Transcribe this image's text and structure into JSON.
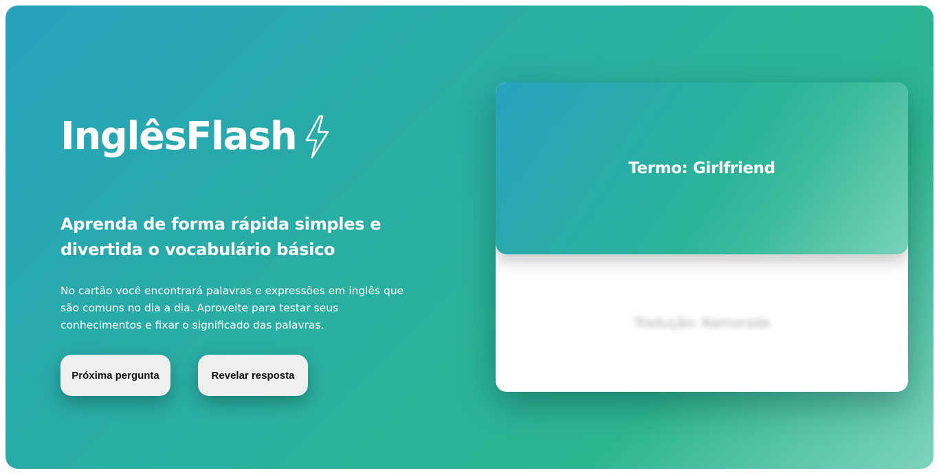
{
  "brand": {
    "title": "InglêsFlash",
    "icon": "lightning-bolt-icon"
  },
  "hero": {
    "headline": "Aprenda de forma rápida simples e divertida o vocabulário básico",
    "description": "No cartão você encontrará palavras e expressões em inglês que são comuns no dia a dia. Aproveite para testar seus conhecimentos e fixar o significado das palavras."
  },
  "actions": {
    "next_label": "Próxima pergunta",
    "reveal_label": "Revelar resposta"
  },
  "flashcard": {
    "term": "Termo: Girlfriend",
    "translation": "Tradução: Namorada",
    "translation_hidden": true
  },
  "colors": {
    "gradient_start": "#27a1bd",
    "gradient_mid": "#2bb398",
    "gradient_end": "#7ed3bd",
    "button_bg": "#efeff0"
  }
}
